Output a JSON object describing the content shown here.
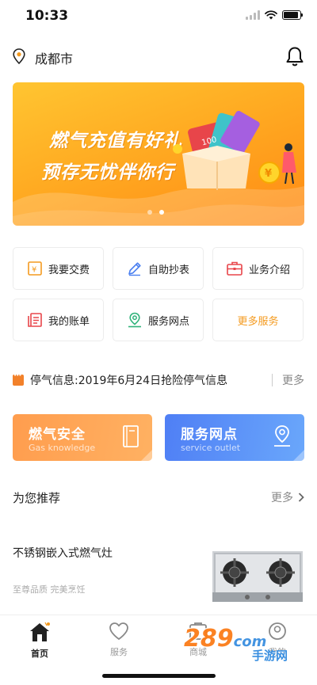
{
  "status_bar": {
    "time": "10:33"
  },
  "header": {
    "city": "成都市"
  },
  "banner": {
    "line1": "燃气充值有好礼",
    "line2": "预存无忧伴你行",
    "art_badge": "100",
    "slides": 2,
    "active_slide": 2
  },
  "services": [
    {
      "label": "我要交费",
      "icon": "payment-icon"
    },
    {
      "label": "自助抄表",
      "icon": "pencil-icon"
    },
    {
      "label": "业务介绍",
      "icon": "briefcase-icon"
    },
    {
      "label": "我的账单",
      "icon": "bill-icon"
    },
    {
      "label": "服务网点",
      "icon": "map-pin-icon"
    },
    {
      "label": "更多服务",
      "icon": ""
    }
  ],
  "notice": {
    "text": "停气信息:2019年6月24日抢险停气信息",
    "more": "更多"
  },
  "cards": {
    "safety": {
      "title": "燃气安全",
      "subtitle": "Gas knowledge"
    },
    "outlet": {
      "title": "服务网点",
      "subtitle": "service outlet"
    }
  },
  "recommend": {
    "title": "为您推荐",
    "more": "更多",
    "product": {
      "name": "不锈钢嵌入式燃气灶",
      "desc": "至尊品质 完美烹饪"
    }
  },
  "tabbar": {
    "items": [
      {
        "label": "首页",
        "active": true
      },
      {
        "label": "服务",
        "active": false
      },
      {
        "label": "商城",
        "active": false
      },
      {
        "label": "我的",
        "active": false
      }
    ]
  },
  "watermark": {
    "text": "289",
    "suffix": "com",
    "sub": "手游网"
  },
  "colors": {
    "accent_orange": "#f49a1e",
    "card_orange": "#ff9d4e",
    "card_blue": "#4f7ff5",
    "notice_orange": "#f2812a"
  }
}
